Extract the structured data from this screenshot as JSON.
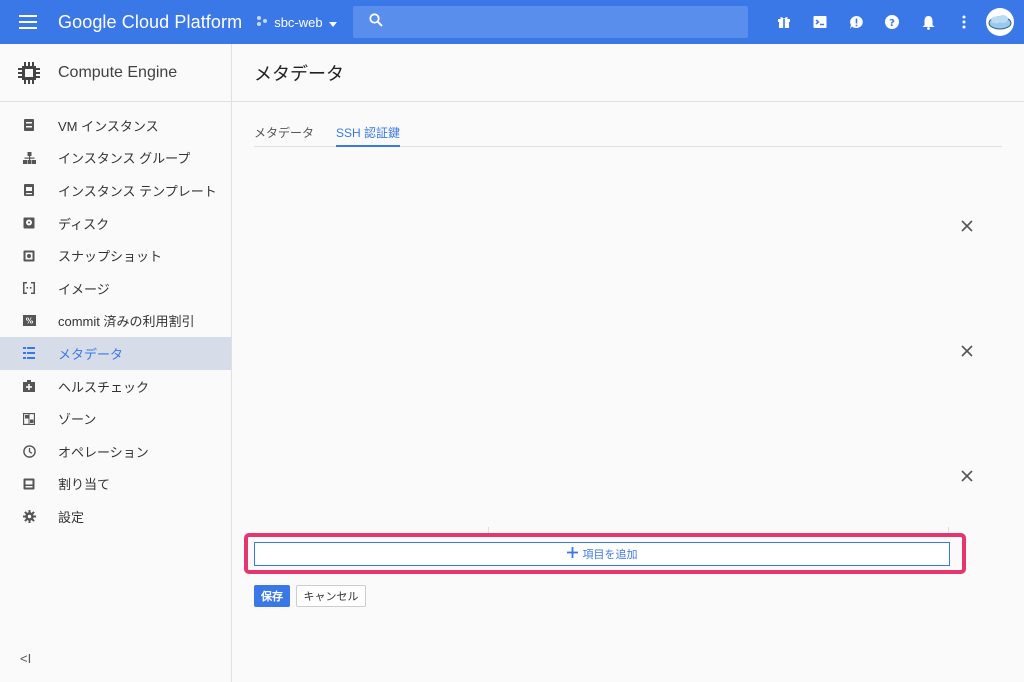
{
  "topbar": {
    "brand": "Google Cloud Platform",
    "project": "sbc-web",
    "search_placeholder": "",
    "icons": [
      "gift-icon",
      "cloud-shell-icon",
      "notifications-alert-icon",
      "help-icon",
      "bell-icon",
      "more-vert-icon",
      "avatar"
    ]
  },
  "sidebar": {
    "product": "Compute Engine",
    "items": [
      {
        "label": "VM インスタンス",
        "icon": "vm-instance-icon"
      },
      {
        "label": "インスタンス グループ",
        "icon": "instance-group-icon"
      },
      {
        "label": "インスタンス テンプレート",
        "icon": "instance-template-icon"
      },
      {
        "label": "ディスク",
        "icon": "disk-icon"
      },
      {
        "label": "スナップショット",
        "icon": "snapshot-icon"
      },
      {
        "label": "イメージ",
        "icon": "image-icon"
      },
      {
        "label": "commit 済みの利用割引",
        "icon": "percent-icon"
      },
      {
        "label": "メタデータ",
        "icon": "metadata-icon",
        "active": true
      },
      {
        "label": "ヘルスチェック",
        "icon": "health-check-icon"
      },
      {
        "label": "ゾーン",
        "icon": "zone-icon"
      },
      {
        "label": "オペレーション",
        "icon": "clock-icon"
      },
      {
        "label": "割り当て",
        "icon": "quota-icon"
      },
      {
        "label": "設定",
        "icon": "gear-icon"
      }
    ],
    "collapse": "<I"
  },
  "main": {
    "title": "メタデータ",
    "tabs": [
      {
        "label": "メタデータ",
        "active": false
      },
      {
        "label": "SSH 認証鍵",
        "active": true
      }
    ],
    "add_item": "項目を追加",
    "save": "保存",
    "cancel": "キャンセル"
  },
  "colors": {
    "topbar": "#3b78e7",
    "accent": "#3b78e7",
    "highlight": "#e6366e",
    "active_item_bg": "#d6dde9"
  }
}
